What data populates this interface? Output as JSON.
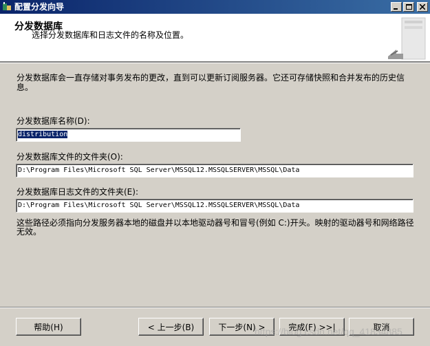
{
  "window": {
    "title": "配置分发向导",
    "controls": [
      "minimize",
      "maximize",
      "close"
    ]
  },
  "header": {
    "title": "分发数据库",
    "subtitle": "选择分发数据库和日志文件的名称及位置。"
  },
  "description": "分发数据库会一直存储对事务发布的更改，直到可以更新订阅服务器。它还可存储快照和合并发布的历史信息。",
  "fields": {
    "db_name": {
      "label": "分发数据库名称(D):",
      "value": "distribution"
    },
    "data_folder": {
      "label": "分发数据库文件的文件夹(O):",
      "value": "D:\\Program Files\\Microsoft SQL Server\\MSSQL12.MSSQLSERVER\\MSSQL\\Data"
    },
    "log_folder": {
      "label": "分发数据库日志文件的文件夹(E):",
      "value": "D:\\Program Files\\Microsoft SQL Server\\MSSQL12.MSSQLSERVER\\MSSQL\\Data"
    }
  },
  "note": "这些路径必须指向分发服务器本地的磁盘并以本地驱动器号和冒号(例如 C:)开头。映射的驱动器号和网络路径无效。",
  "buttons": {
    "help": "帮助(H)",
    "back": "< 上一步(B)",
    "next": "下一步(N) >",
    "finish": "完成(F) >>|",
    "cancel": "取消"
  },
  "watermark": "https://blog.csdn.net/qq_41834885"
}
